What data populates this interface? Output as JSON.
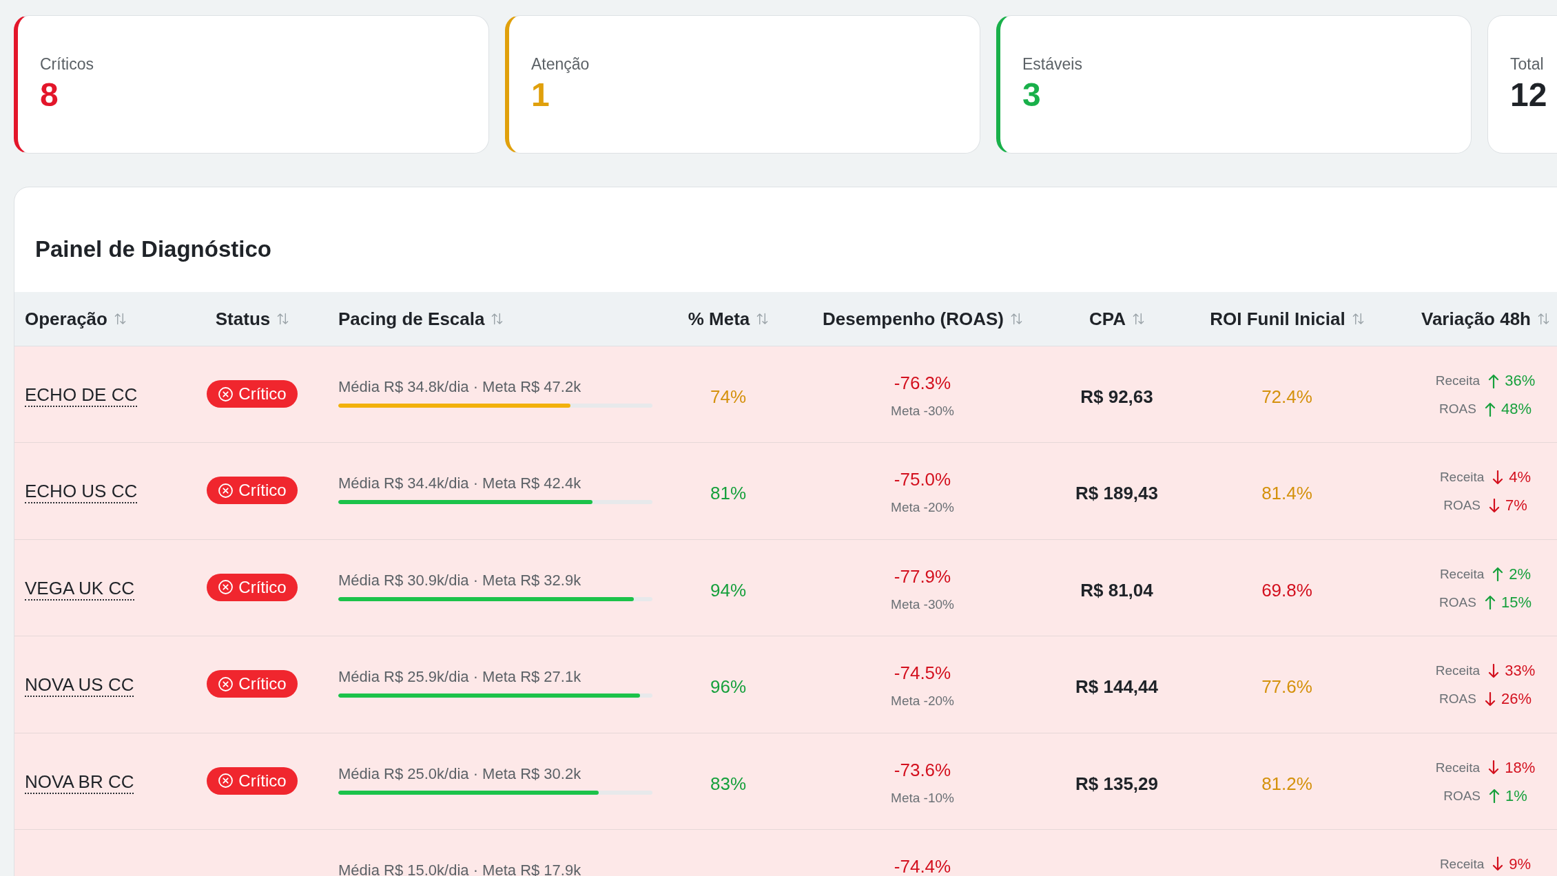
{
  "summary_cards": [
    {
      "label": "Críticos",
      "value": "8",
      "color": "#e3162a"
    },
    {
      "label": "Atenção",
      "value": "1",
      "color": "#e0a00c"
    },
    {
      "label": "Estáveis",
      "value": "3",
      "color": "#19b04a"
    },
    {
      "label": "Total",
      "value": "12"
    }
  ],
  "panel": {
    "title": "Painel de Diagnóstico",
    "table": {
      "columns": [
        {
          "label": "Operação",
          "sortable": true
        },
        {
          "label": "Status",
          "sortable": true
        },
        {
          "label": "Pacing de Escala",
          "sortable": true
        },
        {
          "label": "% Meta",
          "sortable": true
        },
        {
          "label": "Desempenho (ROAS)",
          "sortable": true
        },
        {
          "label": "CPA",
          "sortable": true
        },
        {
          "label": "ROI Funil Inicial",
          "sortable": true
        },
        {
          "label": "Variação 48h",
          "sortable": true
        }
      ],
      "rows": [
        {
          "operation": "ECHO DE CC",
          "status": {
            "label": "Crítico",
            "kind": "critical"
          },
          "pacing": {
            "text": "Média R$ 34.8k/dia · Meta R$ 47.2k",
            "level": 0.74,
            "color": "#f2b10c"
          },
          "meta_pct": {
            "text": "74%",
            "color": "#d4910c"
          },
          "roas": {
            "value": "-76.3%",
            "target": "Meta -30%"
          },
          "cpa": "R$ 92,63",
          "roi": {
            "text": "72.4%",
            "color": "#d4910c"
          },
          "variation": [
            {
              "label": "Receita",
              "kind": "up",
              "value": "36%"
            },
            {
              "label": "ROAS",
              "kind": "up",
              "value": "48%"
            }
          ]
        },
        {
          "operation": "ECHO US CC",
          "status": {
            "label": "Crítico",
            "kind": "critical"
          },
          "pacing": {
            "text": "Média R$ 34.4k/dia · Meta R$ 42.4k",
            "level": 0.81,
            "color": "#1cc24a"
          },
          "meta_pct": {
            "text": "81%",
            "color": "#16a03c"
          },
          "roas": {
            "value": "-75.0%",
            "target": "Meta -20%"
          },
          "cpa": "R$ 189,43",
          "roi": {
            "text": "81.4%",
            "color": "#d4910c"
          },
          "variation": [
            {
              "label": "Receita",
              "kind": "down",
              "value": "4%"
            },
            {
              "label": "ROAS",
              "kind": "down",
              "value": "7%"
            }
          ]
        },
        {
          "operation": "VEGA UK CC",
          "status": {
            "label": "Crítico",
            "kind": "critical"
          },
          "pacing": {
            "text": "Média R$ 30.9k/dia · Meta R$ 32.9k",
            "level": 0.94,
            "color": "#1cc24a"
          },
          "meta_pct": {
            "text": "94%",
            "color": "#16a03c"
          },
          "roas": {
            "value": "-77.9%",
            "target": "Meta -30%"
          },
          "cpa": "R$ 81,04",
          "roi": {
            "text": "69.8%",
            "color": "#d3101e"
          },
          "variation": [
            {
              "label": "Receita",
              "kind": "up",
              "value": "2%"
            },
            {
              "label": "ROAS",
              "kind": "up",
              "value": "15%"
            }
          ]
        },
        {
          "operation": "NOVA US CC",
          "status": {
            "label": "Crítico",
            "kind": "critical"
          },
          "pacing": {
            "text": "Média R$ 25.9k/dia · Meta R$ 27.1k",
            "level": 0.96,
            "color": "#1cc24a"
          },
          "meta_pct": {
            "text": "96%",
            "color": "#16a03c"
          },
          "roas": {
            "value": "-74.5%",
            "target": "Meta -20%"
          },
          "cpa": "R$ 144,44",
          "roi": {
            "text": "77.6%",
            "color": "#d4910c"
          },
          "variation": [
            {
              "label": "Receita",
              "kind": "down",
              "value": "33%"
            },
            {
              "label": "ROAS",
              "kind": "down",
              "value": "26%"
            }
          ]
        },
        {
          "operation": "NOVA BR CC",
          "status": {
            "label": "Crítico",
            "kind": "critical"
          },
          "pacing": {
            "text": "Média R$ 25.0k/dia · Meta R$ 30.2k",
            "level": 0.83,
            "color": "#1cc24a"
          },
          "meta_pct": {
            "text": "83%",
            "color": "#16a03c"
          },
          "roas": {
            "value": "-73.6%",
            "target": "Meta -10%"
          },
          "cpa": "R$ 135,29",
          "roi": {
            "text": "81.2%",
            "color": "#d4910c"
          },
          "variation": [
            {
              "label": "Receita",
              "kind": "down",
              "value": "18%"
            },
            {
              "label": "ROAS",
              "kind": "up",
              "value": "1%"
            }
          ]
        },
        {
          "status": {
            "kind": "critical"
          },
          "pacing": {
            "text": "Média R$ 15.0k/dia · Meta R$ 17.9k"
          },
          "roas": {
            "value": "-74.4%"
          },
          "variation": [
            {
              "label": "Receita",
              "kind": "down",
              "value": "9%"
            }
          ]
        }
      ]
    }
  }
}
